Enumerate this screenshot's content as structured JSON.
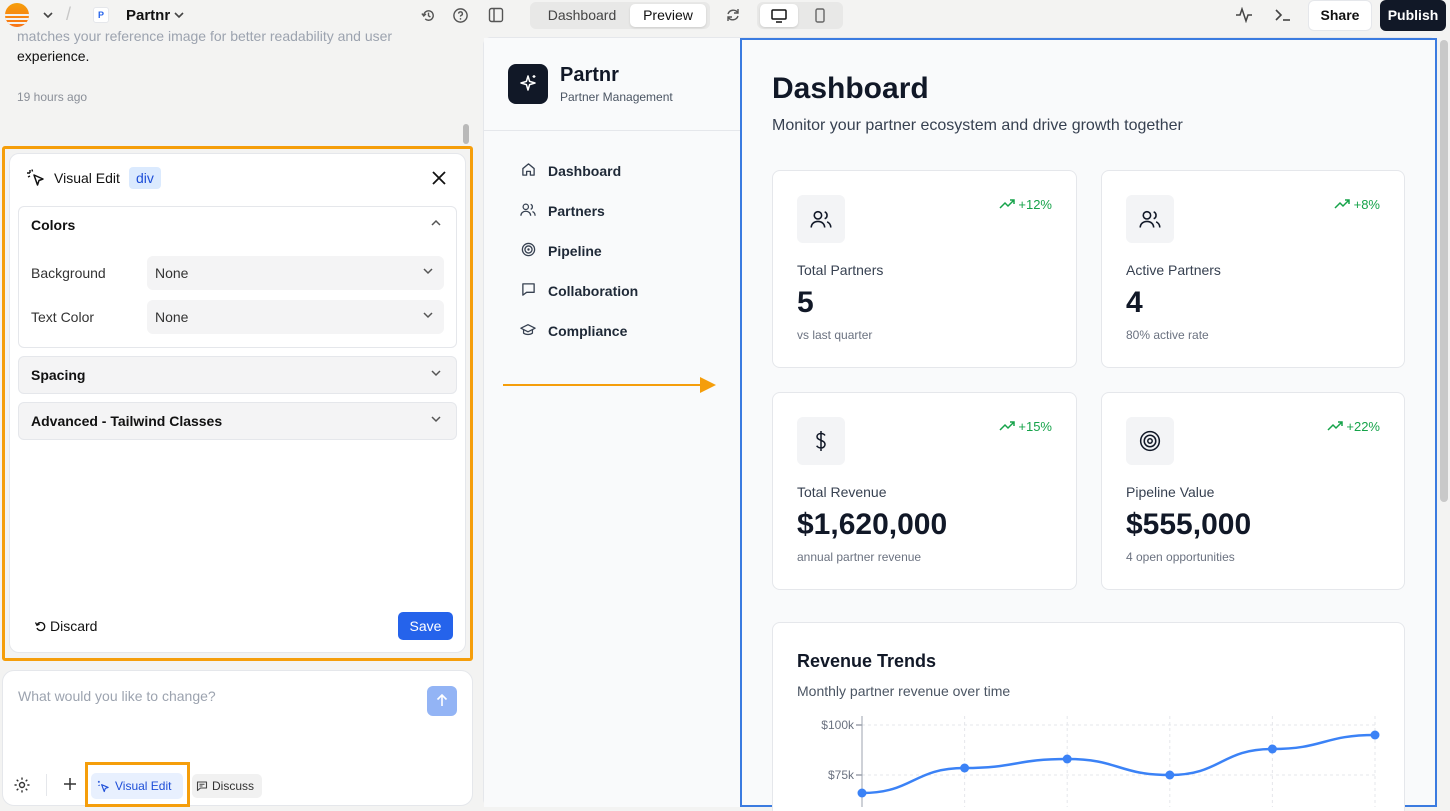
{
  "topbar": {
    "project_name": "Partnr",
    "project_logo_text": "P",
    "tabs": [
      {
        "label": "Dashboard"
      },
      {
        "label": "Preview"
      }
    ],
    "share_label": "Share",
    "publish_label": "Publish"
  },
  "chat": {
    "message_faded": "matches your reference image for better readability and user",
    "message_line": "experience.",
    "timestamp": "19 hours ago",
    "input_placeholder": "What would you like to change?",
    "visual_edit_label": "Visual Edit",
    "discuss_label": "Discuss"
  },
  "visual_edit": {
    "title": "Visual Edit",
    "element_tag": "div",
    "sections": {
      "colors": "Colors",
      "spacing": "Spacing",
      "advanced": "Advanced - Tailwind Classes"
    },
    "fields": {
      "background_label": "Background",
      "background_value": "None",
      "text_color_label": "Text Color",
      "text_color_value": "None"
    },
    "discard_label": "Discard",
    "save_label": "Save"
  },
  "app": {
    "brand": {
      "name": "Partnr",
      "subtitle": "Partner Management"
    },
    "nav": [
      {
        "label": "Dashboard",
        "icon": "home-icon"
      },
      {
        "label": "Partners",
        "icon": "users-icon"
      },
      {
        "label": "Pipeline",
        "icon": "target-icon"
      },
      {
        "label": "Collaboration",
        "icon": "message-icon"
      },
      {
        "label": "Compliance",
        "icon": "graduation-cap-icon"
      }
    ],
    "heading": "Dashboard",
    "subheading": "Monitor your partner ecosystem and drive growth together",
    "stats": [
      {
        "label": "Total Partners",
        "value": "5",
        "note": "vs last quarter",
        "trend": "+12%",
        "icon": "users-icon"
      },
      {
        "label": "Active Partners",
        "value": "4",
        "note": "80% active rate",
        "trend": "+8%",
        "icon": "users-icon"
      },
      {
        "label": "Total Revenue",
        "value": "$1,620,000",
        "note": "annual partner revenue",
        "trend": "+15%",
        "icon": "dollar-icon"
      },
      {
        "label": "Pipeline Value",
        "value": "$555,000",
        "note": "4 open opportunities",
        "trend": "+22%",
        "icon": "target-icon"
      }
    ],
    "chart": {
      "title": "Revenue Trends",
      "subtitle": "Monthly partner revenue over time"
    }
  },
  "colors": {
    "accent": "#2563eb",
    "highlight": "#f59e0b",
    "trend": "#16a34a",
    "dark": "#111827"
  },
  "chart_data": {
    "type": "line",
    "title": "Revenue Trends",
    "subtitle": "Monthly partner revenue over time",
    "ytick_labels": [
      "$100k",
      "$75k"
    ],
    "y_ticks": [
      100000,
      75000
    ],
    "ylim": [
      50000,
      100000
    ],
    "grid": true,
    "series": [
      {
        "values": [
          66000,
          78500,
          83000,
          75000,
          88000,
          95000
        ]
      }
    ]
  }
}
